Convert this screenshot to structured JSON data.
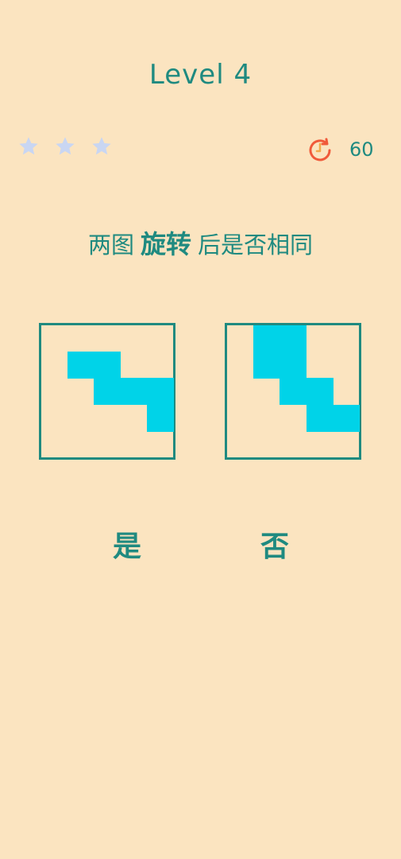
{
  "header": {
    "level_label": "Level 4"
  },
  "stars": {
    "total": 3,
    "earned": 0,
    "color": "#c9d6f2"
  },
  "timer": {
    "icon": "clock-icon",
    "value": "60",
    "icon_color": "#f05a3a"
  },
  "question": {
    "prefix": "两图",
    "emphasis": "旋转",
    "suffix": "后是否相同"
  },
  "puzzle": {
    "grid_size": 5,
    "fill_color": "#00d3e8",
    "border_color": "#1f8a80",
    "left_board_cells": [
      [
        1,
        1
      ],
      [
        1,
        2
      ],
      [
        2,
        2
      ],
      [
        2,
        3
      ],
      [
        2,
        4
      ],
      [
        3,
        4
      ]
    ],
    "right_board_cells": [
      [
        0,
        1
      ],
      [
        0,
        2
      ],
      [
        1,
        1
      ],
      [
        1,
        2
      ],
      [
        2,
        2
      ],
      [
        2,
        3
      ],
      [
        3,
        3
      ],
      [
        3,
        4
      ]
    ]
  },
  "answers": {
    "yes_label": "是",
    "no_label": "否"
  }
}
